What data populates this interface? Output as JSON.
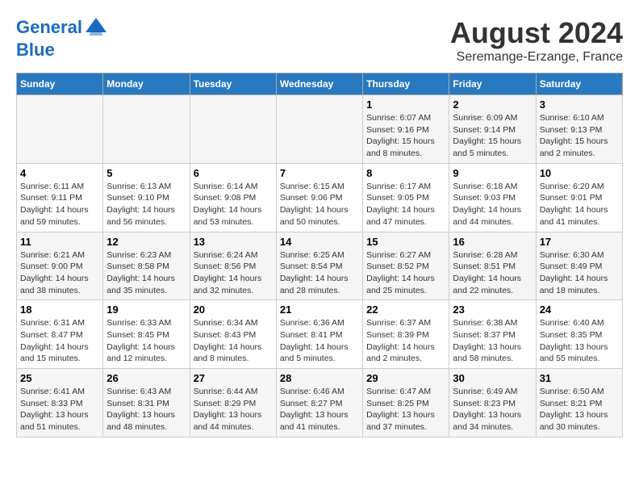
{
  "header": {
    "logo_line1": "General",
    "logo_line2": "Blue",
    "month_title": "August 2024",
    "location": "Seremange-Erzange, France"
  },
  "weekdays": [
    "Sunday",
    "Monday",
    "Tuesday",
    "Wednesday",
    "Thursday",
    "Friday",
    "Saturday"
  ],
  "weeks": [
    [
      {
        "day": "",
        "info": ""
      },
      {
        "day": "",
        "info": ""
      },
      {
        "day": "",
        "info": ""
      },
      {
        "day": "",
        "info": ""
      },
      {
        "day": "1",
        "info": "Sunrise: 6:07 AM\nSunset: 9:16 PM\nDaylight: 15 hours\nand 8 minutes."
      },
      {
        "day": "2",
        "info": "Sunrise: 6:09 AM\nSunset: 9:14 PM\nDaylight: 15 hours\nand 5 minutes."
      },
      {
        "day": "3",
        "info": "Sunrise: 6:10 AM\nSunset: 9:13 PM\nDaylight: 15 hours\nand 2 minutes."
      }
    ],
    [
      {
        "day": "4",
        "info": "Sunrise: 6:11 AM\nSunset: 9:11 PM\nDaylight: 14 hours\nand 59 minutes."
      },
      {
        "day": "5",
        "info": "Sunrise: 6:13 AM\nSunset: 9:10 PM\nDaylight: 14 hours\nand 56 minutes."
      },
      {
        "day": "6",
        "info": "Sunrise: 6:14 AM\nSunset: 9:08 PM\nDaylight: 14 hours\nand 53 minutes."
      },
      {
        "day": "7",
        "info": "Sunrise: 6:15 AM\nSunset: 9:06 PM\nDaylight: 14 hours\nand 50 minutes."
      },
      {
        "day": "8",
        "info": "Sunrise: 6:17 AM\nSunset: 9:05 PM\nDaylight: 14 hours\nand 47 minutes."
      },
      {
        "day": "9",
        "info": "Sunrise: 6:18 AM\nSunset: 9:03 PM\nDaylight: 14 hours\nand 44 minutes."
      },
      {
        "day": "10",
        "info": "Sunrise: 6:20 AM\nSunset: 9:01 PM\nDaylight: 14 hours\nand 41 minutes."
      }
    ],
    [
      {
        "day": "11",
        "info": "Sunrise: 6:21 AM\nSunset: 9:00 PM\nDaylight: 14 hours\nand 38 minutes."
      },
      {
        "day": "12",
        "info": "Sunrise: 6:23 AM\nSunset: 8:58 PM\nDaylight: 14 hours\nand 35 minutes."
      },
      {
        "day": "13",
        "info": "Sunrise: 6:24 AM\nSunset: 8:56 PM\nDaylight: 14 hours\nand 32 minutes."
      },
      {
        "day": "14",
        "info": "Sunrise: 6:25 AM\nSunset: 8:54 PM\nDaylight: 14 hours\nand 28 minutes."
      },
      {
        "day": "15",
        "info": "Sunrise: 6:27 AM\nSunset: 8:52 PM\nDaylight: 14 hours\nand 25 minutes."
      },
      {
        "day": "16",
        "info": "Sunrise: 6:28 AM\nSunset: 8:51 PM\nDaylight: 14 hours\nand 22 minutes."
      },
      {
        "day": "17",
        "info": "Sunrise: 6:30 AM\nSunset: 8:49 PM\nDaylight: 14 hours\nand 18 minutes."
      }
    ],
    [
      {
        "day": "18",
        "info": "Sunrise: 6:31 AM\nSunset: 8:47 PM\nDaylight: 14 hours\nand 15 minutes."
      },
      {
        "day": "19",
        "info": "Sunrise: 6:33 AM\nSunset: 8:45 PM\nDaylight: 14 hours\nand 12 minutes."
      },
      {
        "day": "20",
        "info": "Sunrise: 6:34 AM\nSunset: 8:43 PM\nDaylight: 14 hours\nand 8 minutes."
      },
      {
        "day": "21",
        "info": "Sunrise: 6:36 AM\nSunset: 8:41 PM\nDaylight: 14 hours\nand 5 minutes."
      },
      {
        "day": "22",
        "info": "Sunrise: 6:37 AM\nSunset: 8:39 PM\nDaylight: 14 hours\nand 2 minutes."
      },
      {
        "day": "23",
        "info": "Sunrise: 6:38 AM\nSunset: 8:37 PM\nDaylight: 13 hours\nand 58 minutes."
      },
      {
        "day": "24",
        "info": "Sunrise: 6:40 AM\nSunset: 8:35 PM\nDaylight: 13 hours\nand 55 minutes."
      }
    ],
    [
      {
        "day": "25",
        "info": "Sunrise: 6:41 AM\nSunset: 8:33 PM\nDaylight: 13 hours\nand 51 minutes."
      },
      {
        "day": "26",
        "info": "Sunrise: 6:43 AM\nSunset: 8:31 PM\nDaylight: 13 hours\nand 48 minutes."
      },
      {
        "day": "27",
        "info": "Sunrise: 6:44 AM\nSunset: 8:29 PM\nDaylight: 13 hours\nand 44 minutes."
      },
      {
        "day": "28",
        "info": "Sunrise: 6:46 AM\nSunset: 8:27 PM\nDaylight: 13 hours\nand 41 minutes."
      },
      {
        "day": "29",
        "info": "Sunrise: 6:47 AM\nSunset: 8:25 PM\nDaylight: 13 hours\nand 37 minutes."
      },
      {
        "day": "30",
        "info": "Sunrise: 6:49 AM\nSunset: 8:23 PM\nDaylight: 13 hours\nand 34 minutes."
      },
      {
        "day": "31",
        "info": "Sunrise: 6:50 AM\nSunset: 8:21 PM\nDaylight: 13 hours\nand 30 minutes."
      }
    ]
  ]
}
